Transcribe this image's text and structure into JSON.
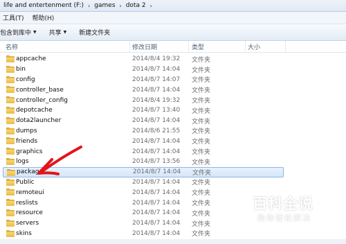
{
  "address": {
    "crumbs": [
      "life and entertenment (F:)",
      "games",
      "dota 2"
    ],
    "separator": "›"
  },
  "menubar": {
    "items": [
      "工具(T)",
      "帮助(H)"
    ]
  },
  "toolbar": {
    "include_library": "包含到库中",
    "share": "共享",
    "new_folder": "新建文件夹",
    "caret": "▼"
  },
  "columns": {
    "name": "名称",
    "date": "修改日期",
    "type": "类型",
    "size": "大小"
  },
  "files": [
    {
      "name": "appcache",
      "date": "2014/8/4 19:32",
      "type": "文件夹"
    },
    {
      "name": "bin",
      "date": "2014/8/7 14:04",
      "type": "文件夹"
    },
    {
      "name": "config",
      "date": "2014/8/7 14:07",
      "type": "文件夹"
    },
    {
      "name": "controller_base",
      "date": "2014/8/7 14:04",
      "type": "文件夹"
    },
    {
      "name": "controller_config",
      "date": "2014/8/4 19:32",
      "type": "文件夹"
    },
    {
      "name": "depotcache",
      "date": "2014/8/7 13:40",
      "type": "文件夹"
    },
    {
      "name": "dota2launcher",
      "date": "2014/8/7 14:04",
      "type": "文件夹"
    },
    {
      "name": "dumps",
      "date": "2014/8/6 21:55",
      "type": "文件夹"
    },
    {
      "name": "friends",
      "date": "2014/8/7 14:04",
      "type": "文件夹"
    },
    {
      "name": "graphics",
      "date": "2014/8/7 14:04",
      "type": "文件夹"
    },
    {
      "name": "logs",
      "date": "2014/8/7 13:56",
      "type": "文件夹"
    },
    {
      "name": "package",
      "date": "2014/8/7 14:04",
      "type": "文件夹",
      "selected": true
    },
    {
      "name": "Public",
      "date": "2014/8/7 14:04",
      "type": "文件夹"
    },
    {
      "name": "remoteui",
      "date": "2014/8/7 14:04",
      "type": "文件夹"
    },
    {
      "name": "reslists",
      "date": "2014/8/7 14:04",
      "type": "文件夹"
    },
    {
      "name": "resource",
      "date": "2014/8/7 14:04",
      "type": "文件夹"
    },
    {
      "name": "servers",
      "date": "2014/8/7 14:04",
      "type": "文件夹"
    },
    {
      "name": "skins",
      "date": "2014/8/7 14:04",
      "type": "文件夹"
    }
  ],
  "watermark": {
    "title": "百科全说",
    "subtitle": "助你轻松解决"
  },
  "colors": {
    "selection": "#d4e6fa",
    "folder": "#e9bb48",
    "arrow": "#e3141b"
  }
}
